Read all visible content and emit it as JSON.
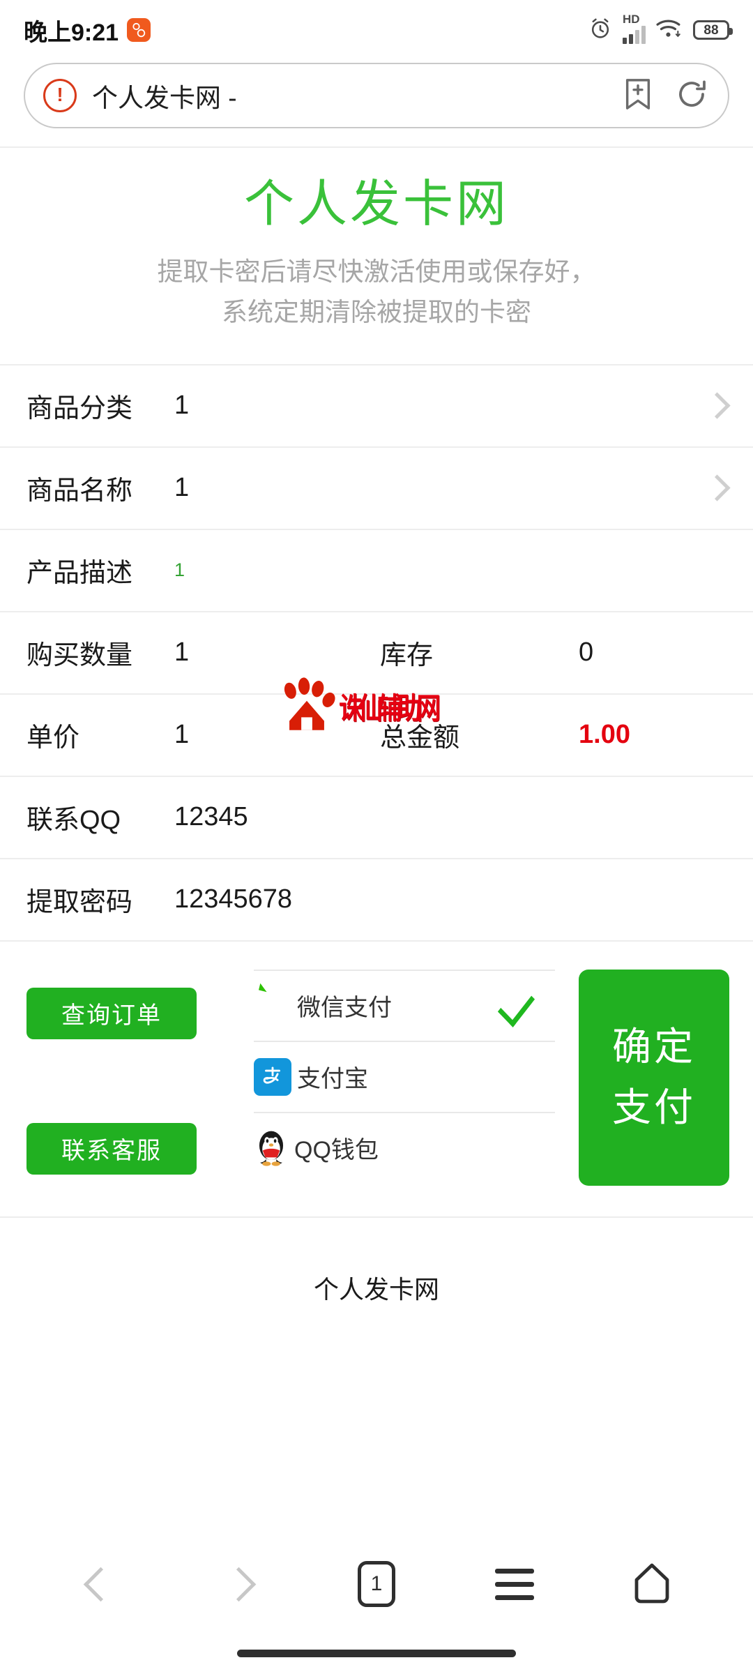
{
  "statusbar": {
    "time": "晚上9:21",
    "app_badge_icon": "qq-badge-icon",
    "alarm_icon": "alarm-clock-icon",
    "network_type": "HD",
    "signal_icon": "signal-bars-icon",
    "wifi_icon": "wifi-icon",
    "battery_level": "88"
  },
  "browser": {
    "warning_icon": "insecure-warning-icon",
    "warning_glyph": "!",
    "page_title": "个人发卡网 -",
    "bookmark_icon": "add-bookmark-icon",
    "refresh_icon": "refresh-icon"
  },
  "hero": {
    "title": "个人发卡网",
    "subtitle_line1": "提取卡密后请尽快激活使用或保存好，",
    "subtitle_line2": "系统定期清除被提取的卡密",
    "title_color": "#3ac13a",
    "subtitle_color": "#a6a6a6"
  },
  "form_rows": [
    {
      "label": "商品分类",
      "value": "1",
      "has_chevron": true
    },
    {
      "label": "商品名称",
      "value": "1",
      "has_chevron": true
    },
    {
      "label": "产品描述",
      "value": "1",
      "value_style": "green"
    },
    {
      "label": "购买数量",
      "value": "1",
      "label2": "库存",
      "value2": "0"
    },
    {
      "label": "单价",
      "value": "1",
      "label2": "总金额",
      "value2": "1.00",
      "value2_style": "red"
    },
    {
      "label": "联系QQ",
      "value": "12345"
    },
    {
      "label": "提取密码",
      "value": "12345678"
    }
  ],
  "watermark": {
    "logo_icon": "baidu-paw-logo-icon",
    "text": "诛仙辅助网",
    "color": "#e60012"
  },
  "actions": {
    "query_order_label": "查询订单",
    "contact_support_label": "联系客服",
    "confirm_pay_label": "确定\n支付",
    "confirm_pay_line1": "确定",
    "confirm_pay_line2": "支付",
    "button_color": "#21b021"
  },
  "payment_methods": [
    {
      "label": "微信支付",
      "icon": "wechat-pay-icon",
      "selected": true
    },
    {
      "label": "支付宝",
      "icon": "alipay-icon",
      "selected": false
    },
    {
      "label": "QQ钱包",
      "icon": "qq-wallet-icon",
      "selected": false
    }
  ],
  "footer": {
    "text": "个人发卡网"
  },
  "bottom_nav": {
    "back_icon": "back-chevron-icon",
    "forward_icon": "forward-chevron-icon",
    "tab_count": "1",
    "menu_icon": "hamburger-menu-icon",
    "home_icon": "home-icon"
  }
}
